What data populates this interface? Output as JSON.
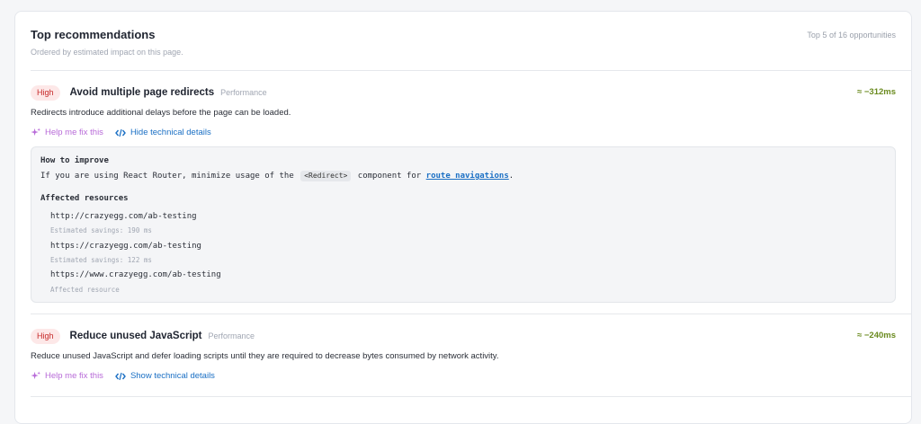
{
  "panel": {
    "title": "Top recommendations",
    "subtitle": "Ordered by estimated impact on this page.",
    "summary": "Top 5 of 16 opportunities"
  },
  "recommendations": [
    {
      "badge": "High",
      "title": "Avoid multiple page redirects",
      "category": "Performance",
      "savings": "≈ −312ms",
      "description": "Redirects introduce additional delays before the page can be loaded.",
      "ai_action": "Help me fix this",
      "tech_action": "Hide technical details",
      "details": {
        "how_heading": "How to improve",
        "how_text_1": "If you are using React Router, minimize usage of the",
        "how_code": "<Redirect>",
        "how_text_2": "component for",
        "how_link": "route navigations",
        "how_text_3": ".",
        "resources_heading": "Affected resources",
        "resources": [
          {
            "url": "http://crazyegg.com/ab-testing",
            "note": "Estimated savings: 190 ms"
          },
          {
            "url": "https://crazyegg.com/ab-testing",
            "note": "Estimated savings: 122 ms"
          },
          {
            "url": "https://www.crazyegg.com/ab-testing",
            "note": "Affected resource"
          }
        ]
      }
    },
    {
      "badge": "High",
      "title": "Reduce unused JavaScript",
      "category": "Performance",
      "savings": "≈ −240ms",
      "description": "Reduce unused JavaScript and defer loading scripts until they are required to decrease bytes consumed by network activity.",
      "ai_action": "Help me fix this",
      "tech_action": "Show technical details"
    }
  ],
  "icons": {
    "ai": "sparkle-icon",
    "tech": "code-icon"
  },
  "colors": {
    "badge_bg": "#fde8e8",
    "badge_text": "#c62828",
    "savings": "#6a8a1e",
    "link": "#1a6fc4",
    "ai": "#b86bd8"
  }
}
